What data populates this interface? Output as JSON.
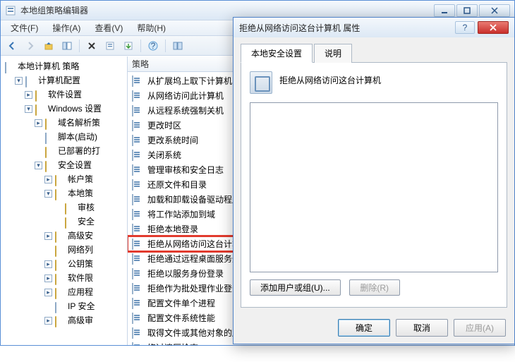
{
  "main_window": {
    "title": "本地组策略编辑器",
    "menu": {
      "file": "文件(F)",
      "action": "操作(A)",
      "view": "查看(V)",
      "help": "帮助(H)"
    }
  },
  "tree": {
    "root": "本地计算机 策略",
    "computer_config": "计算机配置",
    "software": "软件设置",
    "windows": "Windows 设置",
    "dns": "域名解析策",
    "script": "脚本(启动)",
    "deployed": "已部署的打",
    "security": "安全设置",
    "account": "帐户策",
    "local": "本地策",
    "audit": "审核",
    "security2": "安全",
    "advanced": "高级安",
    "network": "网络列",
    "publickey": "公钥策",
    "software_limit": "软件限",
    "app_limit": "应用程",
    "ip_safe": "IP 安全",
    "advanced_audit": "高级审"
  },
  "list": {
    "header": "策略",
    "items": [
      "从扩展坞上取下计算机",
      "从网络访问此计算机",
      "从远程系统强制关机",
      "更改时区",
      "更改系统时间",
      "关闭系统",
      "管理审核和安全日志",
      "还原文件和目录",
      "加载和卸载设备驱动程序",
      "将工作站添加到域",
      "拒绝本地登录",
      "拒绝从网络访问这台计算机",
      "拒绝通过远程桌面服务登录",
      "拒绝以服务身份登录",
      "拒绝作为批处理作业登录",
      "配置文件单个进程",
      "配置文件系统性能",
      "取得文件或其他对象的所有权",
      "绕过遍历检查"
    ],
    "highlighted_index": 11
  },
  "dialog": {
    "title": "拒绝从网络访问这台计算机 属性",
    "tabs": {
      "local": "本地安全设置",
      "explain": "说明"
    },
    "policy_name": "拒绝从网络访问这台计算机",
    "add_button": "添加用户或组(U)...",
    "remove_button": "删除(R)",
    "ok": "确定",
    "cancel": "取消",
    "apply": "应用(A)"
  }
}
